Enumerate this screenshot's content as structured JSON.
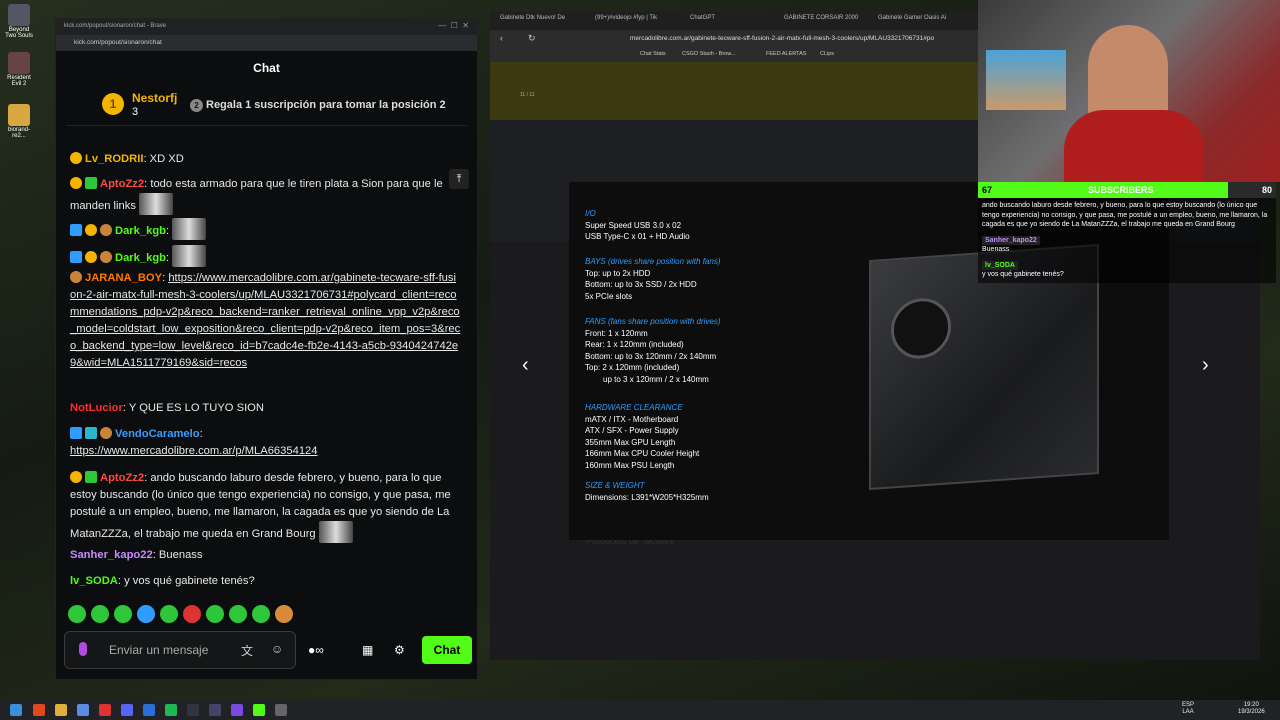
{
  "desktop": {
    "icons": [
      {
        "label": "Beyond Two Souls"
      },
      {
        "label": "Resident Evil 2"
      },
      {
        "label": "biorand-re2..."
      }
    ]
  },
  "chat_window": {
    "url": "kick.com/popout/sionaron/chat - Brave",
    "address": "kick.com/popout/sionaron/chat",
    "title": "Chat",
    "pinned": {
      "rank": "1",
      "user": "Nestorfj",
      "count": "3",
      "rank2": "2",
      "cta": "Regala 1 suscripción para tomar la posición 2"
    },
    "messages": [
      {
        "user": "Lv_RODRII",
        "text": "XD XD"
      },
      {
        "user": "AptoZz2",
        "text": "todo esta armado para que le tiren plata a Sion para que le manden links"
      },
      {
        "user": "Dark_kgb",
        "text": ":"
      },
      {
        "user": "Dark_kgb",
        "text": ":"
      },
      {
        "user": "JARANA_BOY",
        "text": ":",
        "link": "https://www.mercadolibre.com.ar/gabinete-tecware-sff-fusion-2-air-matx-full-mesh-3-coolers/up/MLAU3321706731#polycard_client=recommendations_pdp-v2p&reco_backend=ranker_retrieval_online_vpp_v2p&reco_model=coldstart_low_exposition&reco_client=pdp-v2p&reco_item_pos=3&reco_backend_type=low_level&reco_id=b7cadc4e-fb2e-4143-a5cb-9340424742e9&wid=MLA1511779169&sid=recos"
      },
      {
        "user": "NotLucior",
        "text": ": Y QUE ES LO TUYO SION"
      },
      {
        "user": "VendoCaramelo",
        "text": ":",
        "link": "https://www.mercadolibre.com.ar/p/MLA66354124"
      },
      {
        "user": "AptoZz2",
        "text": ": ando buscando laburo desde febrero, y bueno, para lo que estoy buscando (lo único que tengo experiencia) no consigo, y que pasa, me postulé a un empleo, bueno, me llamaron, la cagada es que yo siendo de La MatanZZZa, el trabajo me queda en Grand Bourg"
      },
      {
        "user": "Sanher_kapo22",
        "text": ": Buenass"
      },
      {
        "user": "lv_SODA",
        "text": ": y vos qué gabinete tenés?"
      }
    ],
    "input_placeholder": "Enviar un mensaje",
    "send_label": "Chat"
  },
  "browser": {
    "tabs": [
      "Gabinete Dtk Nuevo! De",
      "(99+)#videojo #fyp | Tik",
      "ChatGPT",
      "GABINETE CORSAIR 2000",
      "Gabinete Gamer Oasis Ai"
    ],
    "url": "mercadolibre.com.ar/gabinete-tecware-sff-fusion-2-air-matx-full-mesh-3-coolers/up/MLAU3321706731#po",
    "bookmarks": [
      "Chat Stats",
      "CSGO Stash - Brow...",
      "FEED ALERTAS",
      "CLips"
    ],
    "counter": "11 / 11",
    "related": "Productos de Tecware",
    "specs": [
      {
        "h": "I/O",
        "lines": [
          "Super Speed USB 3.0 x 02",
          "USB Type-C x 01 + HD Audio"
        ]
      },
      {
        "h": "BAYS",
        "sub": "(drives share position with fans)",
        "lines": [
          "Top: up to 2x HDD",
          "Bottom: up to 3x SSD / 2x HDD",
          "5x PCIe slots"
        ]
      },
      {
        "h": "FANS",
        "sub": "(fans share position with drives)",
        "lines": [
          "Front: 1 x 120mm",
          "Rear: 1 x 120mm (included)",
          "Bottom: up to 3x 120mm / 2x 140mm",
          "Top: 2 x 120mm (included)",
          "up to 3 x 120mm / 2 x 140mm"
        ]
      },
      {
        "h": "HARDWARE CLEARANCE",
        "lines": [
          "mATX / ITX - Motherboard",
          "ATX / SFX - Power Supply",
          "355mm Max GPU Length",
          "166mm Max CPU Cooler Height",
          "160mm Max PSU Length"
        ]
      },
      {
        "h": "SIZE & WEIGHT",
        "lines": [
          "Dimensions: L391*W205*H325mm"
        ]
      }
    ]
  },
  "stream_overlay": {
    "subs_left": "67",
    "subs_label": "SUBSCRIBERS",
    "subs_right": "80",
    "subs_progress": 0.84,
    "messages": [
      {
        "user": "",
        "text": "ando buscando laburo desde febrero, y bueno, para lo que estoy buscando (lo único que tengo experiencia) no consigo, y que pasa, me postulé a un empleo, bueno, me llamaron, la cagada es que yo siendo de La MatanZZZa, el trabajo me queda en Grand Bourg"
      },
      {
        "user": "Sanher_kapo22",
        "text": "Buenass"
      },
      {
        "user": "lv_SODA",
        "text": "y vos qué gabinete tenés?"
      }
    ]
  },
  "taskbar": {
    "lang": "ESP",
    "lang2": "LAA",
    "time": "19:20",
    "date": "19/3/2026"
  }
}
